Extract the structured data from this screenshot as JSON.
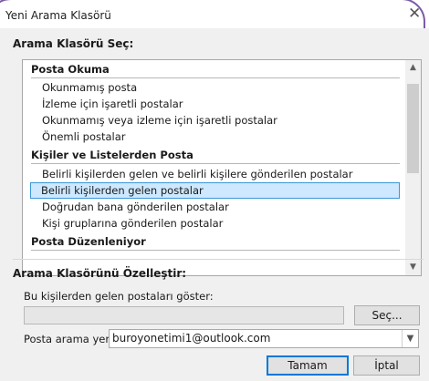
{
  "window": {
    "title": "Yeni Arama Klasörü",
    "close_glyph": "✕"
  },
  "section_select": {
    "label": "Arama Klasörü Seç:"
  },
  "list": {
    "groups": [
      {
        "header": "Posta Okuma",
        "items": [
          "Okunmamış posta",
          "İzleme için işaretli postalar",
          "Okunmamış veya izleme için işaretli postalar",
          "Önemli postalar"
        ]
      },
      {
        "header": "Kişiler ve Listelerden Posta",
        "items": [
          "Belirli kişilerden gelen ve belirli kişilere gönderilen postalar",
          "Belirli kişilerden gelen postalar",
          "Doğrudan bana gönderilen postalar",
          "Kişi gruplarına gönderilen postalar"
        ]
      },
      {
        "header": "Posta Düzenleniyor",
        "items": []
      }
    ],
    "selected_item": "Belirli kişilerden gelen postalar"
  },
  "section_customize": {
    "label": "Arama Klasörünü Özelleştir:",
    "show_from_label": "Bu kişilerden gelen postaları göster:",
    "show_from_value": "",
    "choose_button": "Seç...",
    "search_in_label": "Posta arama yeri:",
    "search_in_value": "buroyonetimi1@outlook.com"
  },
  "buttons": {
    "ok": "Tamam",
    "cancel": "İptal"
  },
  "colors": {
    "frame": "#7b5aa6",
    "selection": "#cde8ff",
    "selection_border": "#3c97db",
    "default_button_border": "#0078d7"
  }
}
